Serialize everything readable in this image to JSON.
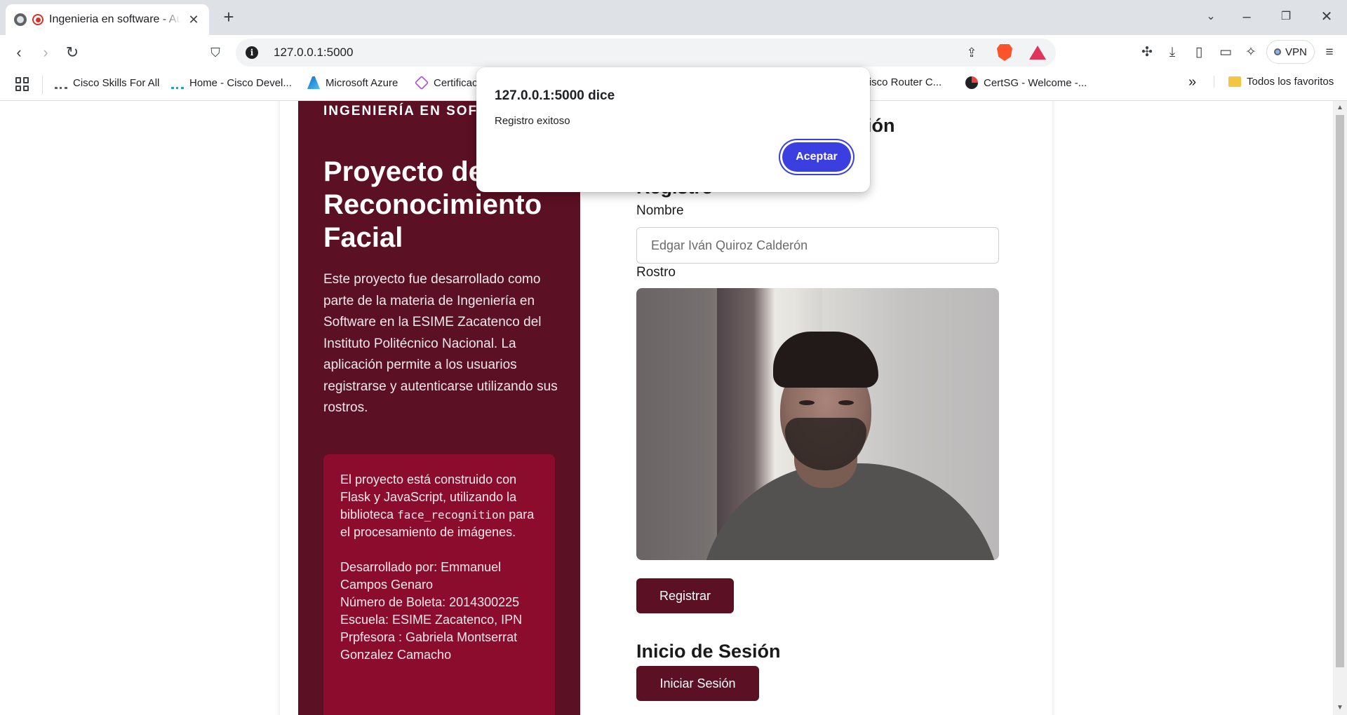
{
  "browser": {
    "tab_title": "Ingenieria en software - Autenticación",
    "url": "127.0.0.1:5000",
    "vpn_label": "VPN",
    "bookmarks": [
      "Cisco Skills For All",
      "Home - Cisco Devel...",
      "Microsoft Azure",
      "Certificac",
      "Cisco Router C...",
      "CertSG - Welcome -..."
    ],
    "all_bookmarks_label": "Todos los favoritos",
    "overflow_label": "»"
  },
  "page": {
    "kicker": "INGENIERÍA EN SOFTWARE",
    "hero_title": "Proyecto de Reconocimiento Facial",
    "hero_description": "Este proyecto fue desarrollado como parte de la materia de Ingeniería en Software en la ESIME Zacatenco del Instituto Politécnico Nacional. La aplicación permite a los usuarios registrarse y autenticarse utilizando sus rostros.",
    "info_box": {
      "tech_prefix": "El proyecto está construido con Flask y JavaScript, utilizando la biblioteca",
      "tech_code": "face_recognition",
      "tech_suffix": "para el procesamiento de imágenes.",
      "developer": "Desarrollado por: Emmanuel Campos Genaro",
      "boleta": "Número de Boleta: 2014300225",
      "school": "Escuela: ESIME Zacatenco, IPN",
      "teacher": "Prpfesora : Gabriela Montserrat Gonzalez Camacho"
    },
    "main_heading_partial": "esión",
    "register_heading_partial": "Registro",
    "name_label": "Nombre",
    "name_value": "Edgar Iván Quiroz Calderón",
    "face_label": "Rostro",
    "register_button": "Registrar",
    "login_heading": "Inicio de Sesión",
    "login_button": "Iniciar Sesión"
  },
  "alert": {
    "title": "127.0.0.1:5000 dice",
    "message": "Registro exitoso",
    "ok_label": "Aceptar"
  },
  "colors": {
    "brand": "#5b1023",
    "info_box": "#8b0c2c",
    "dialog_button": "#3b3fe0"
  }
}
